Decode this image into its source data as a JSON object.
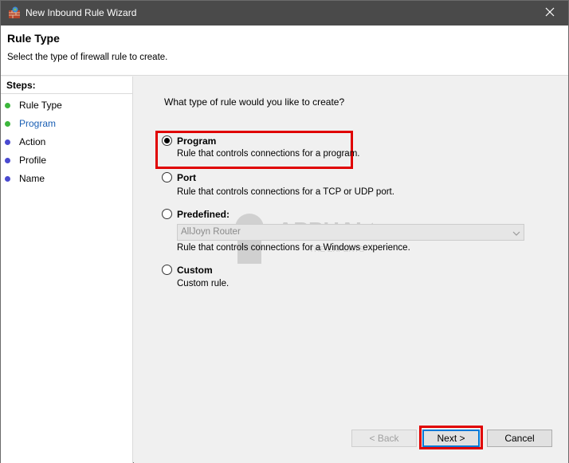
{
  "window": {
    "title": "New Inbound Rule Wizard",
    "close_glyph": "✕"
  },
  "header": {
    "heading": "Rule Type",
    "subheading": "Select the type of firewall rule to create."
  },
  "sidebar": {
    "title": "Steps:",
    "items": [
      {
        "label": "Rule Type",
        "status": "done",
        "color": "#3cb73c"
      },
      {
        "label": "Program",
        "status": "current",
        "color": "#3cb73c"
      },
      {
        "label": "Action",
        "status": "pending",
        "color": "#4a4ad0"
      },
      {
        "label": "Profile",
        "status": "pending",
        "color": "#4a4ad0"
      },
      {
        "label": "Name",
        "status": "pending",
        "color": "#4a4ad0"
      }
    ]
  },
  "content": {
    "question": "What type of rule would you like to create?",
    "options": [
      {
        "label": "Program",
        "description": "Rule that controls connections for a program.",
        "selected": true
      },
      {
        "label": "Port",
        "description": "Rule that controls connections for a TCP or UDP port.",
        "selected": false
      },
      {
        "label": "Predefined:",
        "description": "Rule that controls connections for a Windows experience.",
        "selected": false
      },
      {
        "label": "Custom",
        "description": "Custom rule.",
        "selected": false
      }
    ],
    "predefined_select": {
      "value": "AllJoyn Router",
      "enabled": false
    }
  },
  "watermark": {
    "text": "APPUALS",
    "subtext": "THE EXPERTS"
  },
  "buttons": {
    "back": "< Back",
    "next": "Next >",
    "cancel": "Cancel"
  },
  "colors": {
    "titlebar": "#4a4a4a",
    "highlight": "#e00000",
    "accent": "#0078d7"
  }
}
